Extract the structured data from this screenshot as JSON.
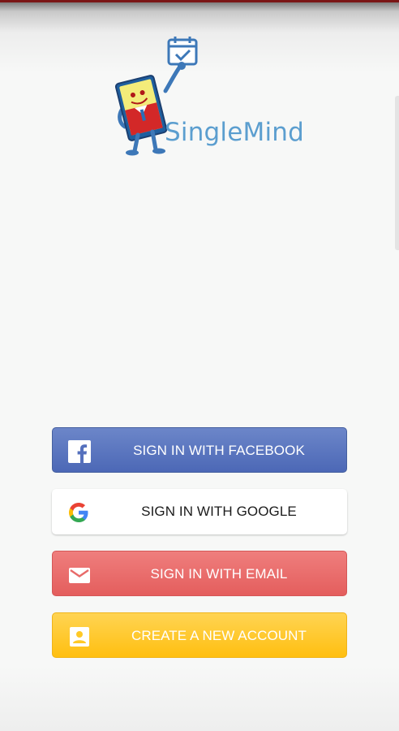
{
  "app": {
    "logo_text": "SingleMind",
    "mascot_icon": "clipboard-mascot-icon"
  },
  "buttons": {
    "facebook": {
      "label": "SIGN IN WITH FACEBOOK",
      "icon": "facebook-icon"
    },
    "google": {
      "label": "SIGN IN WITH GOOGLE",
      "icon": "google-icon"
    },
    "email": {
      "label": "SIGN IN WITH EMAIL",
      "icon": "envelope-icon"
    },
    "create": {
      "label": "CREATE A NEW ACCOUNT",
      "icon": "contact-card-icon"
    }
  },
  "colors": {
    "facebook": "#5570bd",
    "email": "#e86a69",
    "create": "#ffc926",
    "brand_text": "#5b9ecf"
  }
}
